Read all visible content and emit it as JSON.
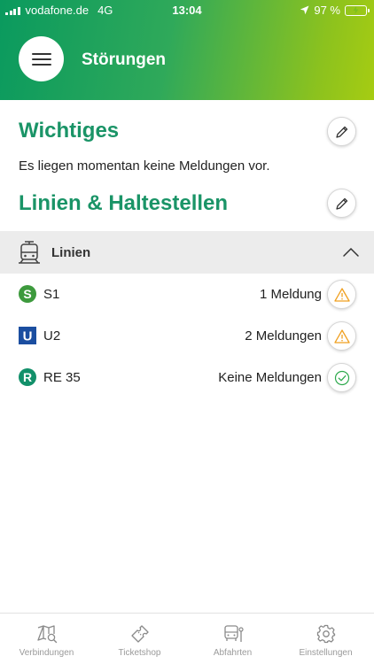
{
  "status_bar": {
    "carrier": "vodafone.de",
    "network": "4G",
    "time": "13:04",
    "battery": "97 %"
  },
  "header": {
    "title": "Störungen"
  },
  "important": {
    "title": "Wichtiges",
    "message": "Es liegen momentan keine Meldungen vor."
  },
  "lines_stops": {
    "title": "Linien & Haltestellen"
  },
  "lines_group": {
    "label": "Linien",
    "items": [
      {
        "badge": "S",
        "name": "S1",
        "status": "1 Meldung",
        "state": "warning"
      },
      {
        "badge": "U",
        "name": "U2",
        "status": "2 Meldungen",
        "state": "warning"
      },
      {
        "badge": "R",
        "name": "RE 35",
        "status": "Keine Meldungen",
        "state": "ok"
      }
    ]
  },
  "tabs": [
    {
      "label": "Verbindungen",
      "icon": "map-search-icon"
    },
    {
      "label": "Ticketshop",
      "icon": "ticket-icon"
    },
    {
      "label": "Abfahrten",
      "icon": "bus-stop-icon"
    },
    {
      "label": "Einstellungen",
      "icon": "gear-icon"
    }
  ],
  "colors": {
    "brand_green": "#1a9467",
    "warning": "#f0a020",
    "ok": "#2eaa4d",
    "u_bahn": "#1b4ea0",
    "s_bahn": "#3d9a3d",
    "regional": "#12906a"
  }
}
